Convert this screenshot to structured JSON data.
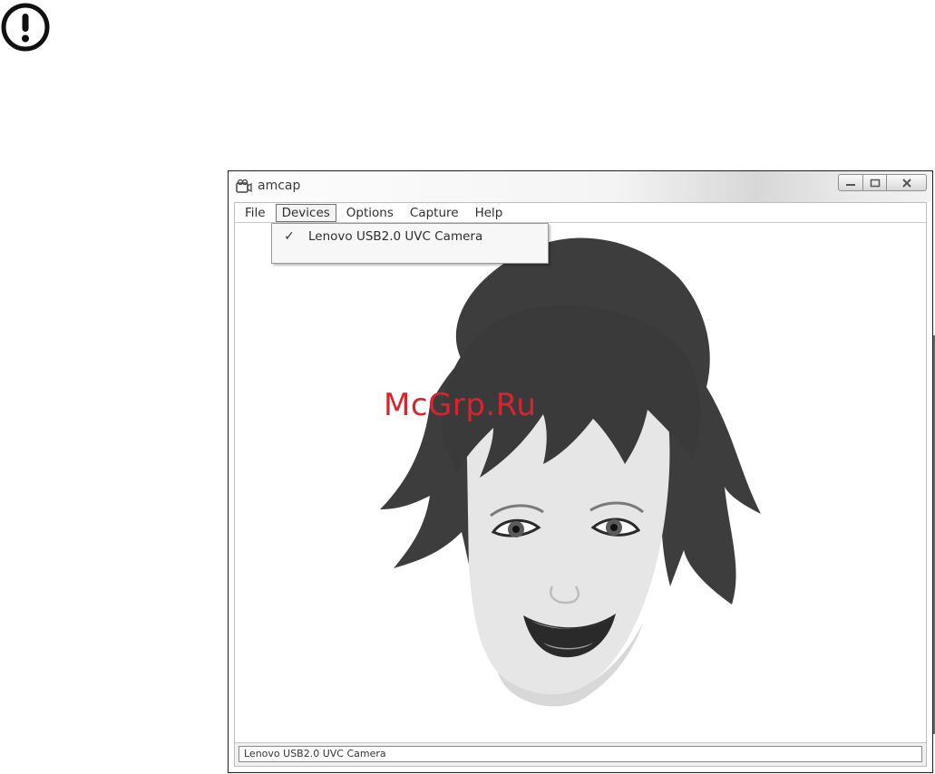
{
  "window": {
    "title": "amcap",
    "controls": {
      "minimize": "minimize",
      "maximize": "maximize",
      "close": "close"
    }
  },
  "menu": {
    "items": [
      {
        "label": "File"
      },
      {
        "label": "Devices",
        "active": true
      },
      {
        "label": "Options"
      },
      {
        "label": "Capture"
      },
      {
        "label": "Help"
      }
    ]
  },
  "dropdown": {
    "items": [
      {
        "label": "Lenovo USB2.0 UVC Camera",
        "checked": true,
        "check_glyph": "✓"
      }
    ]
  },
  "preview": {
    "watermark": "McGrp.Ru"
  },
  "status": {
    "text": "Lenovo USB2.0 UVC Camera"
  },
  "icons": {
    "notice": "exclamation-circle-icon",
    "app": "camera-icon",
    "close": "close-icon"
  },
  "colors": {
    "watermark": "#d9232e",
    "hair": "#3b3b3b",
    "skin": "#e7e7e7"
  }
}
